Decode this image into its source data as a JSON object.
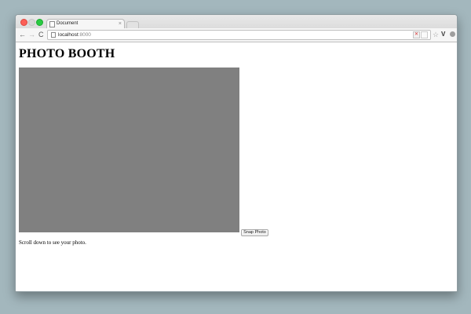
{
  "browser": {
    "tab": {
      "title": "Document",
      "close_label": "×"
    },
    "address_bar": {
      "host": "localhost",
      "port": ":8000"
    },
    "buttons": {
      "back": "←",
      "forward": "→",
      "reload": "C",
      "bookmark": "☆",
      "extension": "V",
      "menu": "≡"
    }
  },
  "page": {
    "heading": "PHOTO BOOTH",
    "snap_button_label": "Snap Photo",
    "hint": "Scroll down to see your photo."
  },
  "colors": {
    "desktop": "#a3b7bd",
    "video_placeholder": "#808080"
  },
  "icons": {
    "tab": "document-icon",
    "address": "page-icon",
    "ext": "v-extension-icon",
    "menu": "hamburger-menu-icon"
  }
}
